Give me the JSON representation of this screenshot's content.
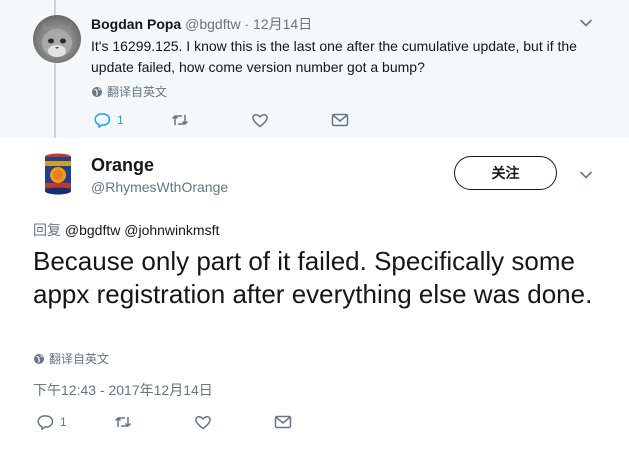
{
  "parent_tweet": {
    "name": "Bogdan Popa",
    "handle": "@bgdftw",
    "separator": "·",
    "date": "12月14日",
    "text": "It's 16299.125. I know this is the last one after the cumulative update, but if the update failed, how come version number got a bump?",
    "translate_label": "翻译自英文",
    "reply_count": "1"
  },
  "main_tweet": {
    "name": "Orange",
    "handle": "@RhymesWthOrange",
    "follow_label": "关注",
    "replying_label": "回复",
    "replying_to": "@bgdftw @johnwinkmsft",
    "text": "Because only part of it failed. Specifically some appx registration after everything else was done.",
    "translate_label": "翻译自英文",
    "timestamp": "下午12:43 - 2017年12月14日",
    "reply_count": "1"
  },
  "colors": {
    "accent": "#1da1f2",
    "secondary_text": "#657786",
    "parent_background": "#f5f8fa"
  },
  "icons": [
    "reply-icon",
    "retweet-icon",
    "like-icon",
    "message-icon",
    "globe-icon",
    "chevron-down-icon"
  ]
}
